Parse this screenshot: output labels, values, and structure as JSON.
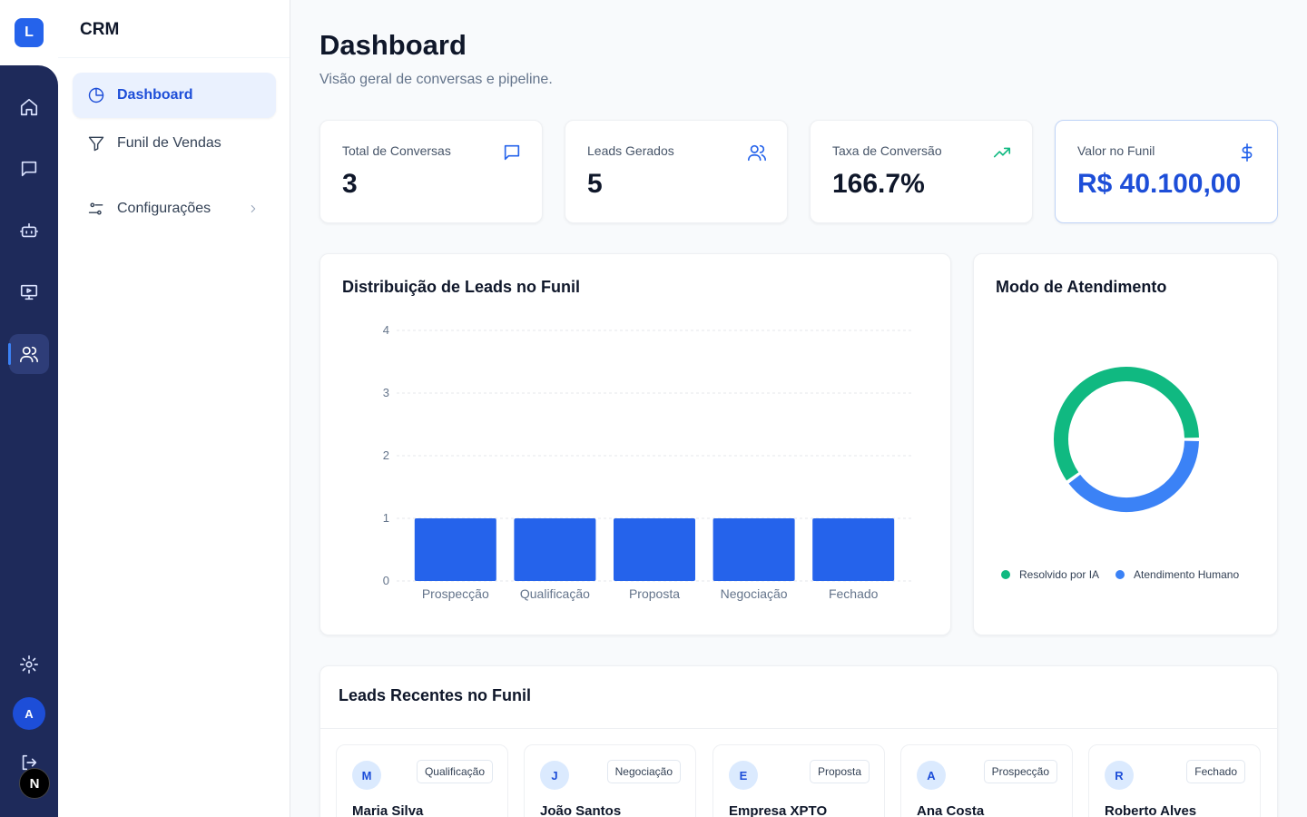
{
  "app": {
    "logo_letter": "L",
    "section_title": "CRM",
    "user_initial": "A",
    "next_badge": "N"
  },
  "rail": {
    "items": [
      {
        "name": "home-icon"
      },
      {
        "name": "chat-icon"
      },
      {
        "name": "bot-icon"
      },
      {
        "name": "presentation-icon"
      },
      {
        "name": "users-icon",
        "active": true
      },
      {
        "name": "gear-icon"
      },
      {
        "name": "logout-icon"
      }
    ]
  },
  "nav": {
    "items": [
      {
        "label": "Dashboard",
        "icon": "pie-chart-icon",
        "active": true
      },
      {
        "label": "Funil de Vendas",
        "icon": "funnel-icon"
      },
      {
        "label": "Configurações",
        "icon": "sliders-icon",
        "has_chevron": true
      }
    ]
  },
  "header": {
    "title": "Dashboard",
    "subtitle": "Visão geral de conversas e pipeline."
  },
  "kpis": [
    {
      "label": "Total de Conversas",
      "value": "3",
      "icon": "message-icon"
    },
    {
      "label": "Leads Gerados",
      "value": "5",
      "icon": "users-icon"
    },
    {
      "label": "Taxa de Conversão",
      "value": "166.7%",
      "icon": "trending-up-icon"
    },
    {
      "label": "Valor no Funil",
      "value": "R$ 40.100,00",
      "icon": "dollar-icon",
      "highlight": true
    }
  ],
  "colors": {
    "accent": "#2563eb",
    "ia": "#10b981",
    "human": "#3b82f6",
    "rail": "#1e2a5a"
  },
  "funnel_card": {
    "title": "Distribuição de Leads no Funil"
  },
  "mode_card": {
    "title": "Modo de Atendimento",
    "legend": [
      {
        "label": "Resolvido por IA",
        "color": "#10b981"
      },
      {
        "label": "Atendimento Humano",
        "color": "#3b82f6"
      }
    ]
  },
  "chart_data": [
    {
      "type": "bar",
      "title": "Distribuição de Leads no Funil",
      "categories": [
        "Prospecção",
        "Qualificação",
        "Proposta",
        "Negociação",
        "Fechado"
      ],
      "values": [
        1,
        1,
        1,
        1,
        1
      ],
      "yticks": [
        "0",
        "1",
        "2",
        "3",
        "4"
      ],
      "ylim": [
        0,
        4
      ],
      "grid": true,
      "color": "#2563eb"
    },
    {
      "type": "pie",
      "title": "Modo de Atendimento",
      "donut": true,
      "labels": [
        "Resolvido por IA",
        "Atendimento Humano"
      ],
      "values": [
        3,
        2
      ],
      "colors": [
        "#10b981",
        "#3b82f6"
      ],
      "legend": "bottom"
    }
  ],
  "leads": {
    "title": "Leads Recentes no Funil",
    "items": [
      {
        "initial": "M",
        "name": "Maria Silva",
        "stage": "Qualificação"
      },
      {
        "initial": "J",
        "name": "João Santos",
        "stage": "Negociação"
      },
      {
        "initial": "E",
        "name": "Empresa XPTO",
        "stage": "Proposta"
      },
      {
        "initial": "A",
        "name": "Ana Costa",
        "stage": "Prospecção"
      },
      {
        "initial": "R",
        "name": "Roberto Alves",
        "stage": "Fechado"
      }
    ]
  }
}
